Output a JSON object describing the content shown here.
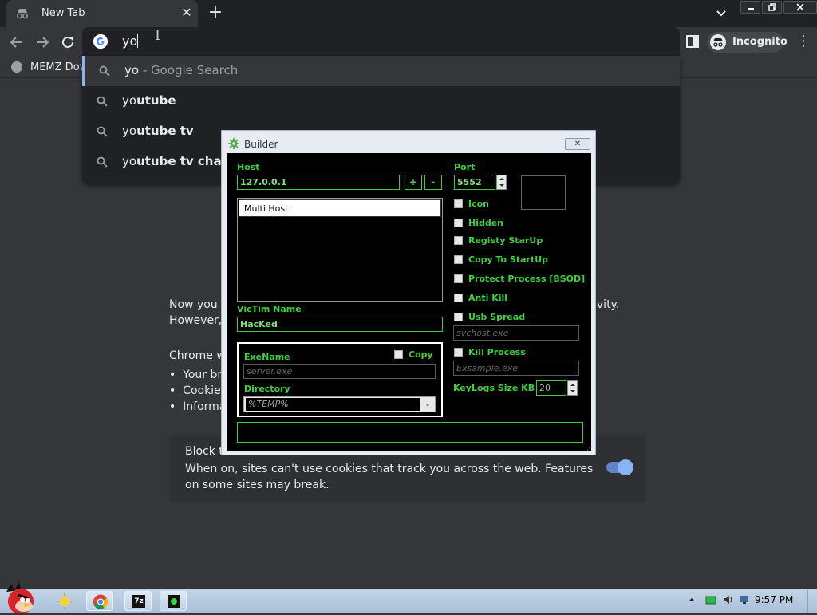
{
  "browser": {
    "tab_title": "New Tab",
    "omnibox_text": "yo",
    "incognito_label": "Incognito",
    "bookmark_label": "MEMZ Dow"
  },
  "suggestions": [
    {
      "bold": "yo",
      "rest": "",
      "extra": " - Google Search"
    },
    {
      "bold": "",
      "rest": "yo",
      "boldtail": "utube",
      "extra": ""
    },
    {
      "bold": "",
      "rest": "yo",
      "boldtail": "utube tv",
      "extra": ""
    },
    {
      "bold": "",
      "rest": "yo",
      "boldtail": "utube tv chann",
      "extra": ""
    }
  ],
  "page": {
    "line1a": "Now you c",
    "line1b": "ivity.",
    "line2": "However, c",
    "chrome_line": "Chrome wo",
    "bullets": [
      "Your bro",
      "Cookies",
      "Informa"
    ],
    "cookie_title": "Block t",
    "cookie_desc": "When on, sites can't use cookies that track you across the web. Features on some sites may break."
  },
  "builder": {
    "title": "Builder",
    "close_label": "✕",
    "host_label": "Host",
    "host_value": "127.0.0.1",
    "plus": "+",
    "minus": "-",
    "multi_host": "Multi Host",
    "victim_label": "VicTim Name",
    "victim_value": "HacKed",
    "exename_label": "ExeName",
    "copy_label": "Copy",
    "exename_value": "server.exe",
    "directory_label": "Directory",
    "directory_value": "%TEMP%",
    "port_label": "Port",
    "port_value": "5552",
    "options": [
      "Icon",
      "Hidden",
      "Registy StarUp",
      "Copy To StartUp",
      "Protect Process [BSOD]",
      "Anti Kill",
      "Usb Spread"
    ],
    "usb_value": "svchost.exe",
    "kill_label": "Kill Process",
    "kill_value": "Exsample.exe",
    "keylogs_label": "KeyLogs Size KB",
    "keylogs_value": "20"
  },
  "taskbar": {
    "clock": "9:57 PM",
    "app_7z": "7z"
  },
  "colors": {
    "accent_green": "#3cd13c",
    "chrome_dark": "#202124",
    "chrome_bg": "#35363a",
    "toggle_blue": "#8ab4f8"
  }
}
